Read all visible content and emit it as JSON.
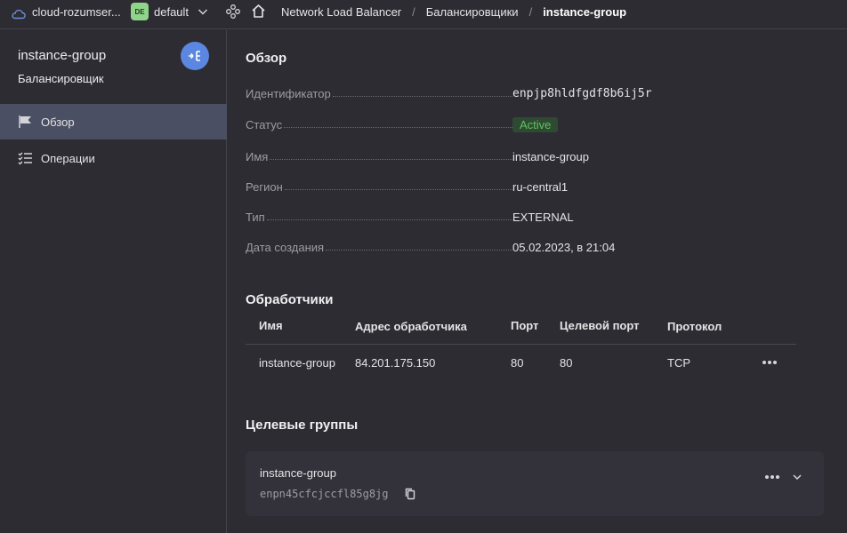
{
  "topbar": {
    "cloud_name": "cloud-rozumser...",
    "folder_badge": "DE",
    "folder_name": "default",
    "breadcrumbs": [
      "Network Load Balancer",
      "Балансировщики",
      "instance-group"
    ]
  },
  "sidebar": {
    "title": "instance-group",
    "subtitle": "Балансировщик",
    "items": [
      {
        "label": "Обзор",
        "active": true
      },
      {
        "label": "Операции",
        "active": false
      }
    ]
  },
  "overview": {
    "heading": "Обзор",
    "props": [
      {
        "key": "Идентификатор",
        "value": "enpjp8hldfgdf8b6ij5r"
      },
      {
        "key": "Статус",
        "value": "Active"
      },
      {
        "key": "Имя",
        "value": "instance-group"
      },
      {
        "key": "Регион",
        "value": "ru-central1"
      },
      {
        "key": "Тип",
        "value": "EXTERNAL"
      },
      {
        "key": "Дата создания",
        "value": "05.02.2023, в 21:04"
      }
    ]
  },
  "listeners": {
    "heading": "Обработчики",
    "columns": [
      "Имя",
      "Адрес обработчика",
      "Порт",
      "Целевой порт",
      "Протокол"
    ],
    "rows": [
      [
        "instance-group",
        "84.201.175.150",
        "80",
        "80",
        "TCP"
      ]
    ]
  },
  "target_groups": {
    "heading": "Целевые группы",
    "items": [
      {
        "name": "instance-group",
        "id": "enpn45cfcjccfl85g8jg"
      }
    ]
  },
  "colors": {
    "accent": "#5b87e0",
    "status_active": "#5cc45f",
    "sidebar_active": "#4b4f63"
  }
}
